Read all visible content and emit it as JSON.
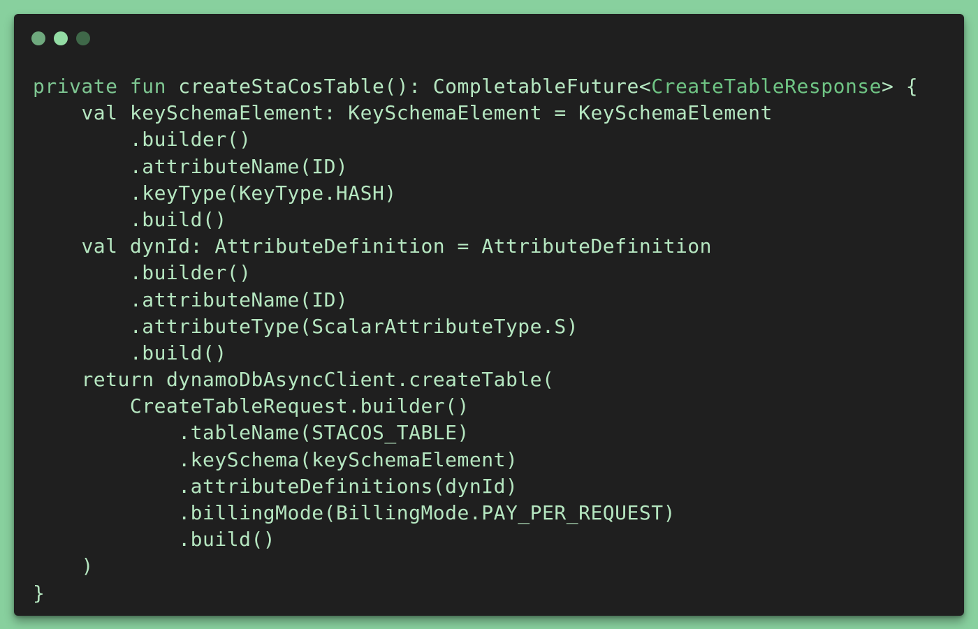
{
  "window": {
    "dots": [
      "window-dot",
      "window-dot",
      "window-dot"
    ],
    "colors": {
      "background": "#88d09e",
      "panel": "#1f1f1f",
      "text": "#b5e6c0",
      "keyword": "#7ec692",
      "generic_type": "#6fc484"
    }
  },
  "code": {
    "language": "kotlin",
    "lines": [
      {
        "indent": "",
        "parts": [
          {
            "t": "kw",
            "v": "private fun"
          },
          {
            "t": "plain",
            "v": " createStaCosTable(): CompletableFuture<"
          },
          {
            "t": "gen",
            "v": "CreateTableResponse"
          },
          {
            "t": "plain",
            "v": "> {"
          }
        ]
      },
      {
        "indent": "    ",
        "parts": [
          {
            "t": "plain",
            "v": "val keySchemaElement: KeySchemaElement = KeySchemaElement"
          }
        ]
      },
      {
        "indent": "        ",
        "parts": [
          {
            "t": "plain",
            "v": ".builder()"
          }
        ]
      },
      {
        "indent": "        ",
        "parts": [
          {
            "t": "plain",
            "v": ".attributeName(ID)"
          }
        ]
      },
      {
        "indent": "        ",
        "parts": [
          {
            "t": "plain",
            "v": ".keyType(KeyType.HASH)"
          }
        ]
      },
      {
        "indent": "        ",
        "parts": [
          {
            "t": "plain",
            "v": ".build()"
          }
        ]
      },
      {
        "indent": "    ",
        "parts": [
          {
            "t": "plain",
            "v": "val dynId: AttributeDefinition = AttributeDefinition"
          }
        ]
      },
      {
        "indent": "        ",
        "parts": [
          {
            "t": "plain",
            "v": ".builder()"
          }
        ]
      },
      {
        "indent": "        ",
        "parts": [
          {
            "t": "plain",
            "v": ".attributeName(ID)"
          }
        ]
      },
      {
        "indent": "        ",
        "parts": [
          {
            "t": "plain",
            "v": ".attributeType(ScalarAttributeType.S)"
          }
        ]
      },
      {
        "indent": "        ",
        "parts": [
          {
            "t": "plain",
            "v": ".build()"
          }
        ]
      },
      {
        "indent": "    ",
        "parts": [
          {
            "t": "plain",
            "v": "return dynamoDbAsyncClient.createTable("
          }
        ]
      },
      {
        "indent": "        ",
        "parts": [
          {
            "t": "plain",
            "v": "CreateTableRequest.builder()"
          }
        ]
      },
      {
        "indent": "            ",
        "parts": [
          {
            "t": "plain",
            "v": ".tableName(STACOS_TABLE)"
          }
        ]
      },
      {
        "indent": "            ",
        "parts": [
          {
            "t": "plain",
            "v": ".keySchema(keySchemaElement)"
          }
        ]
      },
      {
        "indent": "            ",
        "parts": [
          {
            "t": "plain",
            "v": ".attributeDefinitions(dynId)"
          }
        ]
      },
      {
        "indent": "            ",
        "parts": [
          {
            "t": "plain",
            "v": ".billingMode(BillingMode.PAY_PER_REQUEST)"
          }
        ]
      },
      {
        "indent": "            ",
        "parts": [
          {
            "t": "plain",
            "v": ".build()"
          }
        ]
      },
      {
        "indent": "    ",
        "parts": [
          {
            "t": "plain",
            "v": ")"
          }
        ]
      },
      {
        "indent": "",
        "parts": [
          {
            "t": "plain",
            "v": "}"
          }
        ]
      }
    ]
  }
}
